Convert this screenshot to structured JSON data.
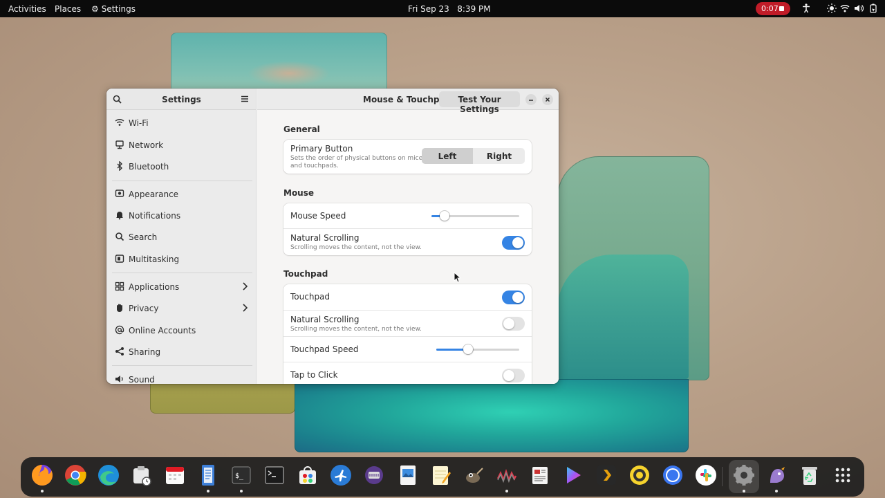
{
  "topbar": {
    "activities": "Activities",
    "places": "Places",
    "app_menu": "Settings",
    "clock": "Fri Sep 23   8:39 PM",
    "recording_time": "0:07"
  },
  "window": {
    "sidebar_title": "Settings",
    "page_title": "Mouse & Touchpad",
    "test_button": "Test Your Settings"
  },
  "sidebar": {
    "items": [
      {
        "label": "Wi-Fi",
        "icon": "wifi-icon"
      },
      {
        "label": "Network",
        "icon": "network-icon"
      },
      {
        "label": "Bluetooth",
        "icon": "bluetooth-icon"
      },
      {
        "label": "Appearance",
        "icon": "appearance-icon"
      },
      {
        "label": "Notifications",
        "icon": "bell-icon"
      },
      {
        "label": "Search",
        "icon": "search-icon"
      },
      {
        "label": "Multitasking",
        "icon": "multitasking-icon"
      },
      {
        "label": "Applications",
        "icon": "applications-icon"
      },
      {
        "label": "Privacy",
        "icon": "hand-icon"
      },
      {
        "label": "Online Accounts",
        "icon": "at-icon"
      },
      {
        "label": "Sharing",
        "icon": "share-icon"
      },
      {
        "label": "Sound",
        "icon": "speaker-icon"
      }
    ]
  },
  "general": {
    "title": "General",
    "primary_button": {
      "label": "Primary Button",
      "subtitle_line1": "Sets the order of physical buttons on mice",
      "subtitle_line2": "and touchpads.",
      "options": [
        "Left",
        "Right"
      ],
      "selected": "Left"
    }
  },
  "mouse": {
    "title": "Mouse",
    "speed_label": "Mouse Speed",
    "speed_value": 0.15,
    "natural_scrolling_label": "Natural Scrolling",
    "natural_scrolling_sub": "Scrolling moves the content, not the view.",
    "natural_scrolling_on": true
  },
  "touchpad": {
    "title": "Touchpad",
    "touchpad_label": "Touchpad",
    "touchpad_on": true,
    "natural_scrolling_label": "Natural Scrolling",
    "natural_scrolling_sub": "Scrolling moves the content, not the view.",
    "natural_scrolling_on": false,
    "speed_label": "Touchpad Speed",
    "speed_value": 0.38,
    "tap_to_click_label": "Tap to Click",
    "tap_to_click_on": false
  },
  "dock": {
    "apps": [
      "firefox",
      "chrome",
      "edge",
      "software-updater",
      "calendar",
      "text-editor",
      "terminal",
      "terminal-alt",
      "software-store",
      "airplane-app",
      "disk-utility",
      "image-viewer",
      "notes",
      "gimp",
      "waveform-app",
      "news-app",
      "play-app",
      "plex",
      "record-app",
      "chat-app",
      "slack",
      "settings",
      "pidgin",
      "trash",
      "app-grid"
    ]
  },
  "colors": {
    "accent": "#3584e4",
    "record": "#c01c28"
  }
}
